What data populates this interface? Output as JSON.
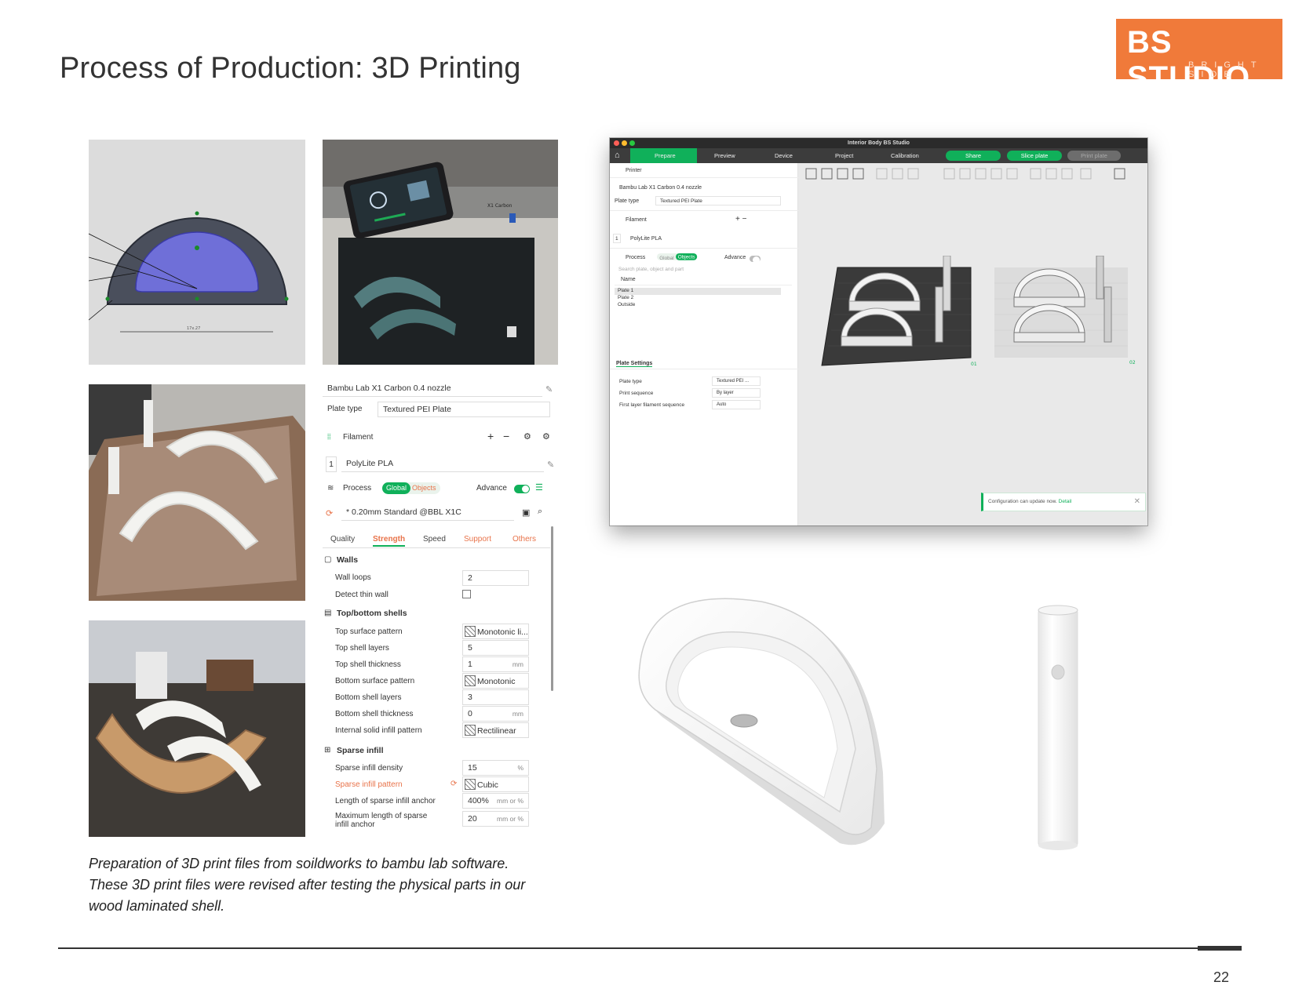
{
  "page": {
    "title": "Process of Production: 3D Printing",
    "number": "22",
    "caption_lines": [
      "Preparation of 3D print files from soildworks to bambu lab software.",
      "These 3D print files were revised after testing the physical parts in our",
      "wood laminated shell."
    ]
  },
  "logo": {
    "main": "BS STUDIO",
    "sub": "BRIGHT SIDE",
    "color": "#f07a3a"
  },
  "photos": {
    "cad_label": "17x.27",
    "printer_label": "X1 Carbon"
  },
  "settings_panel": {
    "printer": "Bambu Lab X1 Carbon 0.4 nozzle",
    "plate_type_label": "Plate type",
    "plate_type_value": "Textured PEI Plate",
    "filament_label": "Filament",
    "filament_index": "1",
    "filament_value": "PolyLite PLA",
    "process_label": "Process",
    "global_label": "Global",
    "objects_label": "Objects",
    "advance_label": "Advance",
    "preset": "* 0.20mm Standard @BBL X1C",
    "tabs": [
      "Quality",
      "Strength",
      "Speed",
      "Support",
      "Others"
    ],
    "walls_heading": "Walls",
    "wall_loops_label": "Wall loops",
    "wall_loops_value": "2",
    "detect_thin_wall_label": "Detect thin wall",
    "shells_heading": "Top/bottom shells",
    "top_surface_pattern_label": "Top surface pattern",
    "top_surface_pattern_value": "Monotonic li...",
    "top_shell_layers_label": "Top shell layers",
    "top_shell_layers_value": "5",
    "top_shell_thickness_label": "Top shell thickness",
    "top_shell_thickness_value": "1",
    "bottom_surface_pattern_label": "Bottom surface pattern",
    "bottom_surface_pattern_value": "Monotonic",
    "bottom_shell_layers_label": "Bottom shell layers",
    "bottom_shell_layers_value": "3",
    "bottom_shell_thickness_label": "Bottom shell thickness",
    "bottom_shell_thickness_value": "0",
    "internal_solid_infill_label": "Internal solid infill pattern",
    "internal_solid_infill_value": "Rectilinear",
    "sparse_heading": "Sparse infill",
    "sparse_density_label": "Sparse infill density",
    "sparse_density_value": "15",
    "sparse_pattern_label": "Sparse infill pattern",
    "sparse_pattern_value": "Cubic",
    "anchor_label": "Length of sparse infill anchor",
    "anchor_value": "400%",
    "anchor_unit": "mm or %",
    "max_anchor_label_1": "Maximum length of sparse",
    "max_anchor_label_2": "infill anchor",
    "max_anchor_value": "20",
    "max_anchor_unit": "mm or %",
    "mm_unit": "mm",
    "pct_unit": "%"
  },
  "app_window": {
    "title": "Interior Body BS Studio",
    "toolbar": {
      "prepare": "Prepare",
      "preview": "Preview",
      "device": "Device",
      "project": "Project",
      "calibration": "Calibration",
      "share": "Share",
      "slice_plate": "Slice plate",
      "print_plate": "Print plate"
    },
    "left": {
      "printer_label": "Printer",
      "printer_value": "Bambu Lab X1 Carbon 0.4 nozzle",
      "plate_type_label": "Plate type",
      "plate_type_value": "Textured PEI Plate",
      "filament_label": "Filament",
      "filament_index": "1",
      "filament_value": "PolyLite PLA",
      "process_label": "Process",
      "global_label": "Global",
      "objects_label": "Objects",
      "advance_label": "Advance",
      "search_placeholder": "Search plate, object and part",
      "name_header": "Name",
      "tree": [
        "Plate 1",
        "Plate 2",
        "Outside"
      ],
      "plate_settings_heading": "Plate Settings",
      "plate_settings": [
        {
          "label": "Plate type",
          "value": "Textured PEI ..."
        },
        {
          "label": "Print sequence",
          "value": "By layer"
        },
        {
          "label": "First layer filament sequence",
          "value": "Auto"
        }
      ]
    },
    "canvas": {
      "plate1_tag": "01",
      "plate2_tag": "02",
      "notice_text": "Configuration can update now.",
      "notice_link": "Detail"
    }
  },
  "colors": {
    "accent_green": "#10b05a",
    "accent_orange": "#e8734a",
    "logo_orange": "#f07a3a"
  }
}
